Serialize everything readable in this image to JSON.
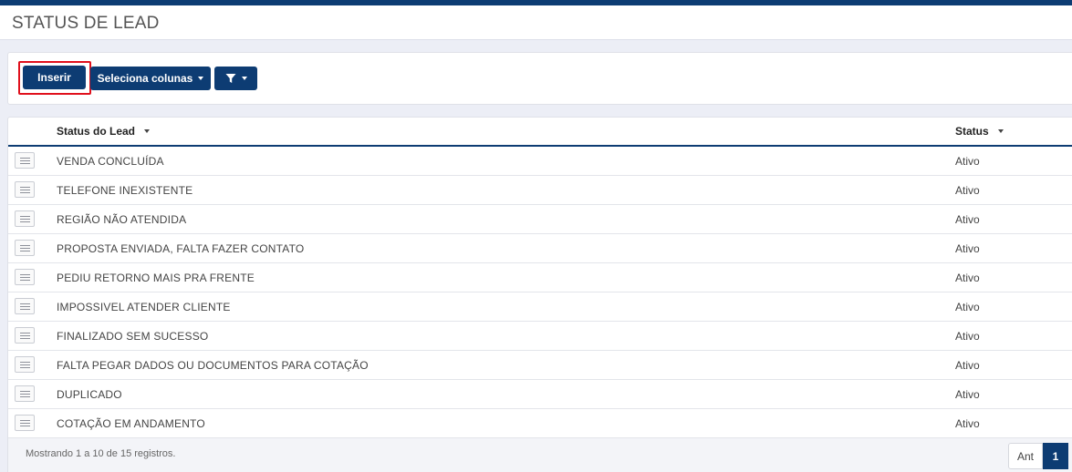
{
  "header": {
    "title": "STATUS DE LEAD"
  },
  "toolbar": {
    "insert_label": "Inserir",
    "columns_label": "Seleciona colunas",
    "filter_icon": "filter-icon"
  },
  "table": {
    "columns": [
      "Status do Lead",
      "Status"
    ],
    "rows": [
      {
        "name": "VENDA CONCLUÍDA",
        "status": "Ativo"
      },
      {
        "name": "TELEFONE INEXISTENTE",
        "status": "Ativo"
      },
      {
        "name": "REGIÃO NÃO ATENDIDA",
        "status": "Ativo"
      },
      {
        "name": "PROPOSTA ENVIADA, FALTA FAZER CONTATO",
        "status": "Ativo"
      },
      {
        "name": "PEDIU RETORNO MAIS PRA FRENTE",
        "status": "Ativo"
      },
      {
        "name": "IMPOSSIVEL ATENDER CLIENTE",
        "status": "Ativo"
      },
      {
        "name": "FINALIZADO SEM SUCESSO",
        "status": "Ativo"
      },
      {
        "name": "FALTA PEGAR DADOS OU DOCUMENTOS PARA COTAÇÃO",
        "status": "Ativo"
      },
      {
        "name": "DUPLICADO",
        "status": "Ativo"
      },
      {
        "name": "COTAÇÃO EM ANDAMENTO",
        "status": "Ativo"
      }
    ]
  },
  "footer": {
    "info": "Mostrando 1 a 10 de 15 registros.",
    "prev_label": "Ant",
    "current_page": "1"
  },
  "colors": {
    "primary": "#0d3c73",
    "highlight": "#e0101c",
    "background": "#eceef6"
  }
}
